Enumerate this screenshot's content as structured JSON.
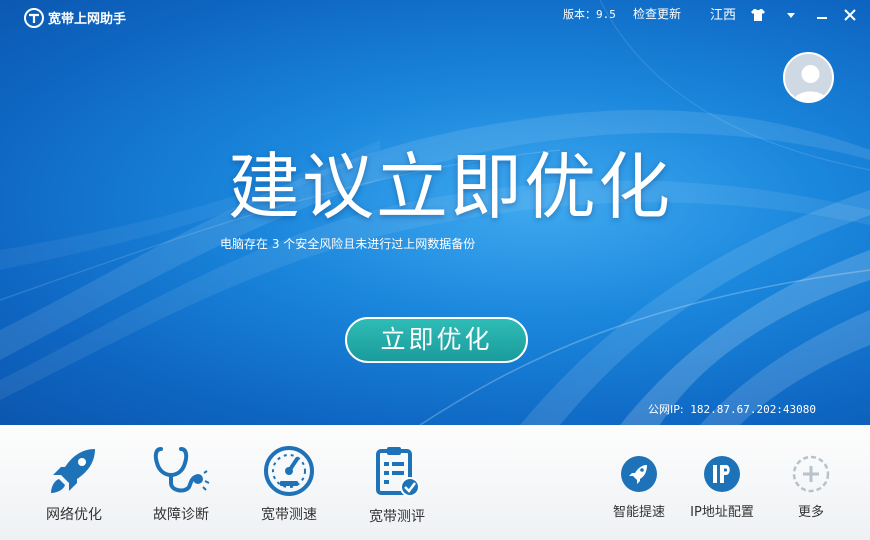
{
  "app": {
    "title": "宽带上网助手"
  },
  "titlebar": {
    "version": "版本：9.5",
    "check_update": "检查更新",
    "region": "江西"
  },
  "icons": {
    "logo": "broadband-logo-icon",
    "skin": "tshirt-icon",
    "menu": "dropdown-arrow-icon",
    "minimize": "minimize-icon",
    "close": "close-icon",
    "avatar": "user-avatar-icon"
  },
  "hero": {
    "headline": "建议立即优化",
    "subtext": "电脑存在 3 个安全风险且未进行过上网数据备份",
    "optimize_button": "立即优化",
    "public_ip_label": "公网IP:",
    "public_ip_value": "182.87.67.202:43080"
  },
  "tools": [
    {
      "label": "网络优化",
      "icon": "rocket-icon"
    },
    {
      "label": "故障诊断",
      "icon": "stethoscope-icon"
    },
    {
      "label": "宽带测速",
      "icon": "speedometer-icon"
    },
    {
      "label": "宽带测评",
      "icon": "clipboard-check-icon"
    }
  ],
  "quick_tools": [
    {
      "label": "智能提速",
      "icon": "rocket-circle-icon"
    },
    {
      "label": "IP地址配置",
      "icon": "ip-circle-icon"
    },
    {
      "label": "更多",
      "icon": "plus-circle-icon"
    }
  ],
  "colors": {
    "hero_blue": "#1a86dc",
    "accent_teal": "#1fa7a4",
    "icon_blue": "#1e73b8"
  }
}
